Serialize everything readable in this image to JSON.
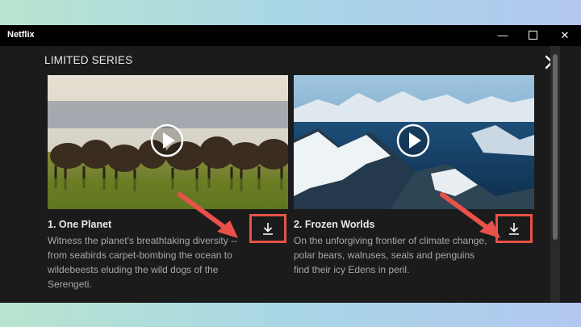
{
  "window": {
    "title": "Netflix",
    "controls": {
      "minimize": "—",
      "maximize": "☐",
      "close": "✕"
    }
  },
  "section": {
    "title": "LIMITED SERIES"
  },
  "episodes": [
    {
      "title": "1. One Planet",
      "description": "Witness the planet's breathtaking diversity -- from seabirds carpet-bombing the ocean to wildebeests eluding the wild dogs of the Serengeti."
    },
    {
      "title": "2. Frozen Worlds",
      "description": "On the unforgiving frontier of climate change, polar bears, walruses, seals and penguins find their icy Edens in peril."
    }
  ],
  "colors": {
    "highlight": "#e8524a",
    "background": "#1b1b1b",
    "titlebar": "#000000"
  },
  "icons": [
    "close-icon",
    "play-icon",
    "download-icon",
    "arrow-annotation"
  ]
}
